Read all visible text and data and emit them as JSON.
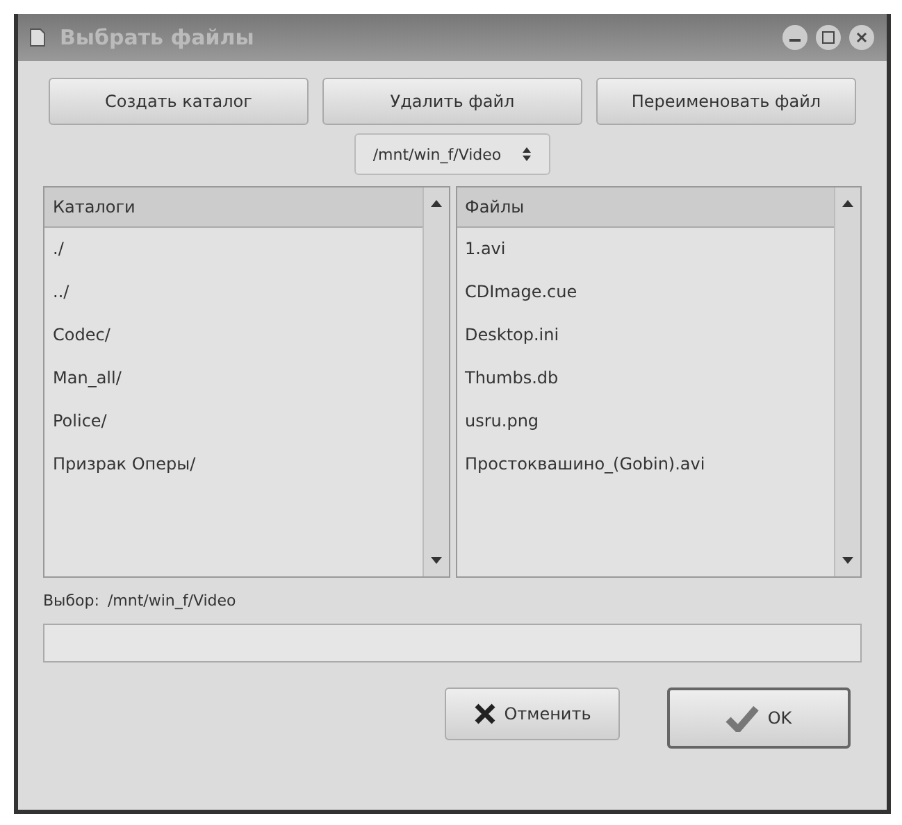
{
  "window": {
    "title": "Выбрать файлы"
  },
  "toolbar": [
    "Создать каталог",
    "Удалить файл",
    "Переименовать файл"
  ],
  "path_dropdown": {
    "value": "/mnt/win_f/Video"
  },
  "folders": {
    "header": "Каталоги",
    "items": [
      "./",
      "../",
      "Codec/",
      "Man_all/",
      "Police/",
      "Призрак Оперы/"
    ]
  },
  "files": {
    "header": "Файлы",
    "items": [
      "1.avi",
      "CDImage.cue",
      "Desktop.ini",
      "Thumbs.db",
      "usru.png",
      "Простоквашино_(Gobin).avi"
    ]
  },
  "selection": {
    "label": "Выбор:",
    "path": "/mnt/win_f/Video"
  },
  "buttons": [
    {
      "kind": "cancel",
      "label": "Отменить"
    },
    {
      "kind": "ok",
      "label": "OK"
    }
  ]
}
